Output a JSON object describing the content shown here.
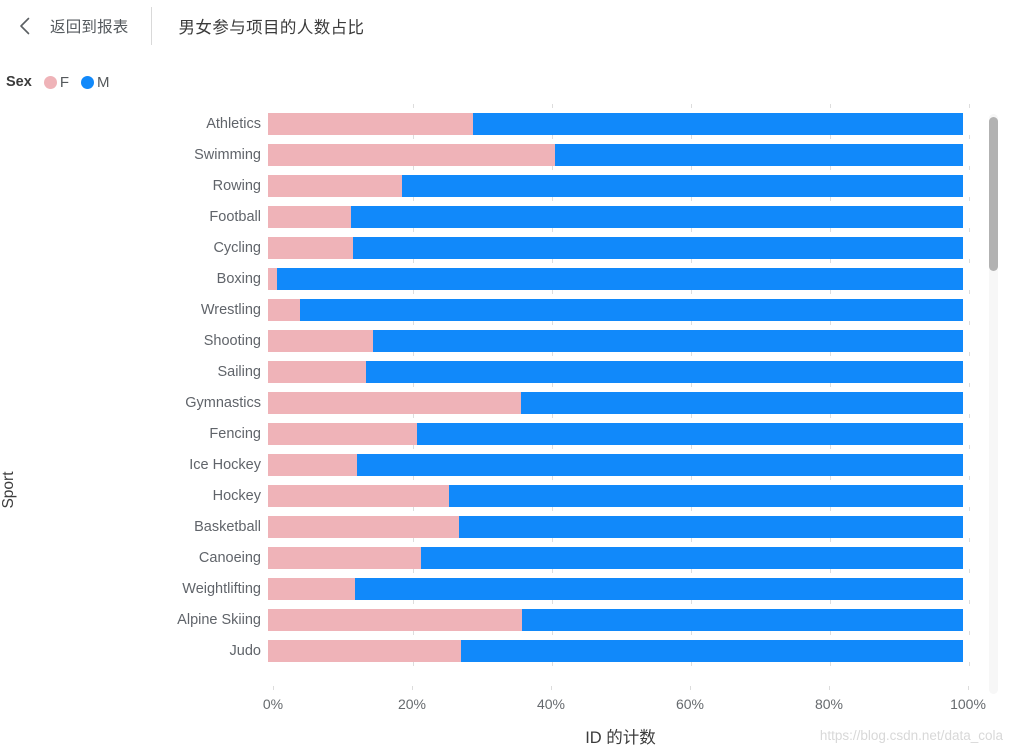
{
  "header": {
    "back_label": "返回到报表",
    "back_icon": "chevron-left-icon",
    "report_title": "男女参与项目的人数占比"
  },
  "legend": {
    "title": "Sex",
    "items": [
      {
        "label": "F",
        "color": "#EFB3B8"
      },
      {
        "label": "M",
        "color": "#1189FA"
      }
    ]
  },
  "colors": {
    "female": "#EFB3B8",
    "male": "#1189FA",
    "axis_text": "#60646a",
    "title_text": "#3b3b3b",
    "scrollbar_thumb": "#b2b2b2",
    "scrollbar_track": "#f7f7f7",
    "watermark": "#d8d8d8"
  },
  "watermark": "https://blog.csdn.net/data_cola",
  "chart_data": {
    "type": "bar",
    "orientation": "horizontal",
    "stacked": true,
    "normalized": true,
    "title": "男女参与项目的人数占比",
    "xlabel": "ID 的计数",
    "ylabel": "Sport",
    "xlim": [
      0,
      100
    ],
    "xtick_labels": [
      "0%",
      "20%",
      "40%",
      "60%",
      "80%",
      "100%"
    ],
    "xtick_values": [
      0,
      20,
      40,
      60,
      80,
      100
    ],
    "grid": false,
    "legend_position": "top-left",
    "categories": [
      "Athletics",
      "Swimming",
      "Rowing",
      "Football",
      "Cycling",
      "Boxing",
      "Wrestling",
      "Shooting",
      "Sailing",
      "Gymnastics",
      "Fencing",
      "Ice Hockey",
      "Hockey",
      "Basketball",
      "Canoeing",
      "Weightlifting",
      "Alpine Skiing",
      "Judo"
    ],
    "series": [
      {
        "name": "F",
        "color": "#EFB3B8",
        "values": [
          29.5,
          41.3,
          19.3,
          11.9,
          12.2,
          1.3,
          4.6,
          15.1,
          14.1,
          36.4,
          21.5,
          12.8,
          26.1,
          27.5,
          22.0,
          12.5,
          36.5,
          27.8
        ]
      },
      {
        "name": "M",
        "color": "#1189FA",
        "values": [
          70.5,
          58.7,
          80.7,
          88.1,
          87.8,
          98.7,
          95.4,
          84.9,
          85.9,
          63.6,
          78.5,
          87.2,
          73.9,
          72.5,
          78.0,
          87.5,
          63.5,
          72.2
        ]
      }
    ]
  }
}
